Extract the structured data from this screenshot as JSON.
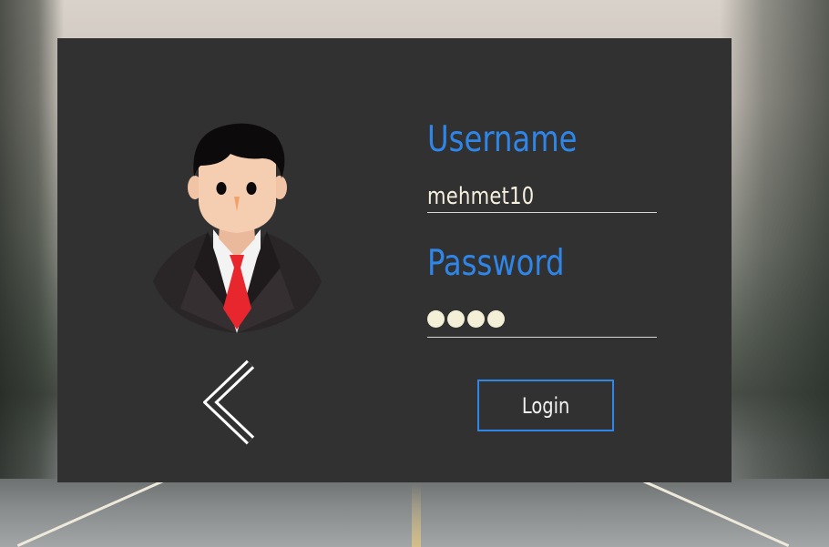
{
  "login": {
    "username_label": "Username",
    "username_value": "mehmet10",
    "password_label": "Password",
    "password_mask_count": 4,
    "login_button_label": "Login"
  },
  "icons": {
    "back": "chevron-left-icon",
    "avatar": "user-avatar-icon"
  },
  "colors": {
    "panel_bg": "#313131",
    "accent": "#2f86e8",
    "input_text": "#f6f1de",
    "tie": "#e8262d"
  }
}
